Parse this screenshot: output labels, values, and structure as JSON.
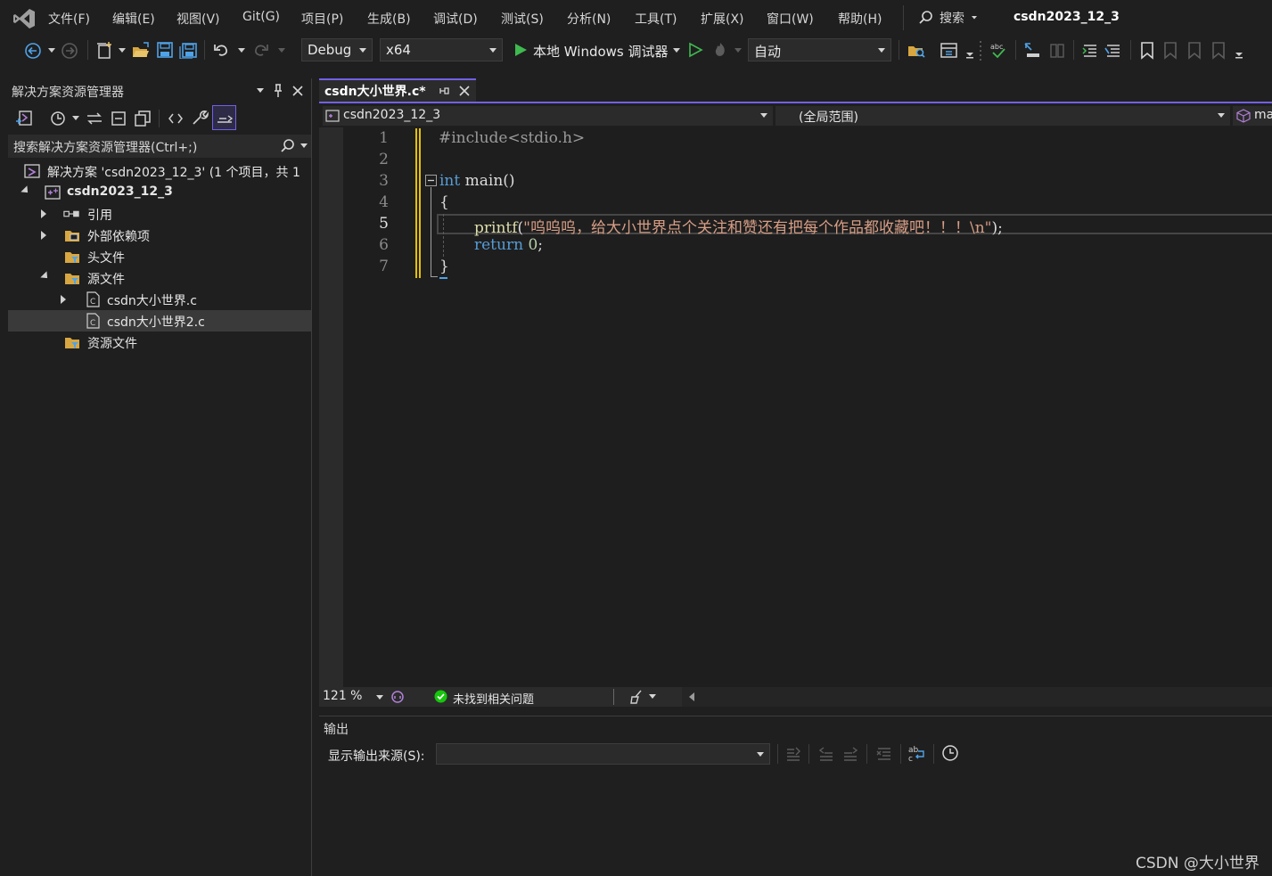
{
  "menu": {
    "items": [
      "文件(F)",
      "编辑(E)",
      "视图(V)",
      "Git(G)",
      "项目(P)",
      "生成(B)",
      "调试(D)",
      "测试(S)",
      "分析(N)",
      "工具(T)",
      "扩展(X)",
      "窗口(W)",
      "帮助(H)"
    ],
    "search_label": "搜索",
    "solution_name": "csdn2023_12_3"
  },
  "toolbar": {
    "configuration": "Debug",
    "platform": "x64",
    "debugger": "本地 Windows 调试器",
    "startup": "自动"
  },
  "solution_explorer": {
    "title": "解决方案资源管理器",
    "search_placeholder": "搜索解决方案资源管理器(Ctrl+;)",
    "tree": {
      "solution": "解决方案 'csdn2023_12_3' (1 个项目，共 1",
      "project": "csdn2023_12_3",
      "references": "引用",
      "external_deps": "外部依赖项",
      "header_files": "头文件",
      "source_files": "源文件",
      "file1": "csdn大小世界.c",
      "file2": "csdn大小世界2.c",
      "resource_files": "资源文件"
    }
  },
  "editor": {
    "tab_label": "csdn大小世界.c*",
    "nav_project": "csdn2023_12_3",
    "nav_scope": "(全局范围)",
    "nav_member": "ma",
    "line_numbers": [
      "1",
      "2",
      "3",
      "4",
      "5",
      "6",
      "7"
    ],
    "code": {
      "l1": "#include<stdio.h>",
      "l3_kw": "int",
      "l3_rest": " main()",
      "l4": "{",
      "l5_fn": "printf",
      "l5_paren": "(",
      "l5_str": "\"呜呜呜，给大小世界点个关注和赞还有把每个作品都收藏吧！！！\\n\"",
      "l5_end": ");",
      "l6_kw": "return",
      "l6_num": " 0",
      "l6_end": ";",
      "l7": "}"
    },
    "zoom": "121 %",
    "issues": "未找到相关问题"
  },
  "output": {
    "title": "输出",
    "source_label": "显示输出来源(S):"
  },
  "watermark": "CSDN @大小世界",
  "colors": {
    "accent": "#7160e8",
    "keyword": "#569cd6",
    "string": "#d69d85",
    "function": "#dcdcaa",
    "number": "#b5cea8",
    "preprocessor": "#9b9b9b",
    "change_bar": "#e5c100",
    "ok_green": "#16c60c"
  }
}
